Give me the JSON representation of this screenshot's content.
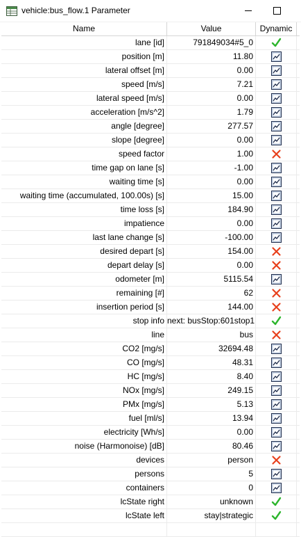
{
  "window": {
    "title": "vehicle:bus_flow.1 Parameter"
  },
  "columns": {
    "name": "Name",
    "value": "Value",
    "dynamic": "Dynamic"
  },
  "rows": [
    {
      "name": "lane [id]",
      "value": "791849034#5_0",
      "dynamic": "check-icon"
    },
    {
      "name": "position [m]",
      "value": "11.80",
      "dynamic": "chart-icon"
    },
    {
      "name": "lateral offset [m]",
      "value": "0.00",
      "dynamic": "chart-icon"
    },
    {
      "name": "speed [m/s]",
      "value": "7.21",
      "dynamic": "chart-icon"
    },
    {
      "name": "lateral speed [m/s]",
      "value": "0.00",
      "dynamic": "chart-icon"
    },
    {
      "name": "acceleration [m/s^2]",
      "value": "1.79",
      "dynamic": "chart-icon"
    },
    {
      "name": "angle [degree]",
      "value": "277.57",
      "dynamic": "chart-icon"
    },
    {
      "name": "slope [degree]",
      "value": "0.00",
      "dynamic": "chart-icon"
    },
    {
      "name": "speed factor",
      "value": "1.00",
      "dynamic": "cross-icon"
    },
    {
      "name": "time gap on lane [s]",
      "value": "-1.00",
      "dynamic": "chart-icon"
    },
    {
      "name": "waiting time [s]",
      "value": "0.00",
      "dynamic": "chart-icon"
    },
    {
      "name": "waiting time (accumulated, 100.00s) [s]",
      "value": "15.00",
      "dynamic": "chart-icon"
    },
    {
      "name": "time loss [s]",
      "value": "184.90",
      "dynamic": "chart-icon"
    },
    {
      "name": "impatience",
      "value": "0.00",
      "dynamic": "chart-icon"
    },
    {
      "name": "last lane change [s]",
      "value": "-100.00",
      "dynamic": "chart-icon"
    },
    {
      "name": "desired depart [s]",
      "value": "154.00",
      "dynamic": "cross-icon"
    },
    {
      "name": "depart delay [s]",
      "value": "0.00",
      "dynamic": "cross-icon"
    },
    {
      "name": "odometer [m]",
      "value": "5115.54",
      "dynamic": "chart-icon"
    },
    {
      "name": "remaining [#]",
      "value": "62",
      "dynamic": "cross-icon"
    },
    {
      "name": "insertion period [s]",
      "value": "144.00",
      "dynamic": "cross-icon"
    },
    {
      "name": "stop info",
      "value": "next: busStop:601stop1",
      "dynamic": "check-icon"
    },
    {
      "name": "line",
      "value": "bus",
      "dynamic": "cross-icon"
    },
    {
      "name": "CO2 [mg/s]",
      "value": "32694.48",
      "dynamic": "chart-icon"
    },
    {
      "name": "CO [mg/s]",
      "value": "48.31",
      "dynamic": "chart-icon"
    },
    {
      "name": "HC [mg/s]",
      "value": "8.40",
      "dynamic": "chart-icon"
    },
    {
      "name": "NOx [mg/s]",
      "value": "249.15",
      "dynamic": "chart-icon"
    },
    {
      "name": "PMx [mg/s]",
      "value": "5.13",
      "dynamic": "chart-icon"
    },
    {
      "name": "fuel [ml/s]",
      "value": "13.94",
      "dynamic": "chart-icon"
    },
    {
      "name": "electricity [Wh/s]",
      "value": "0.00",
      "dynamic": "chart-icon"
    },
    {
      "name": "noise (Harmonoise) [dB]",
      "value": "80.46",
      "dynamic": "chart-icon"
    },
    {
      "name": "devices",
      "value": "person",
      "dynamic": "cross-icon"
    },
    {
      "name": "persons",
      "value": "5",
      "dynamic": "chart-icon"
    },
    {
      "name": "containers",
      "value": "0",
      "dynamic": "chart-icon"
    },
    {
      "name": "lcState right",
      "value": "unknown",
      "dynamic": "check-icon"
    },
    {
      "name": "lcState left",
      "value": "stay|strategic",
      "dynamic": "check-icon"
    }
  ],
  "colors": {
    "check": "#2db52d",
    "cross": "#e8401c",
    "chart_border": "#1c2a4a",
    "chart_fill": "#dfe9f6"
  }
}
